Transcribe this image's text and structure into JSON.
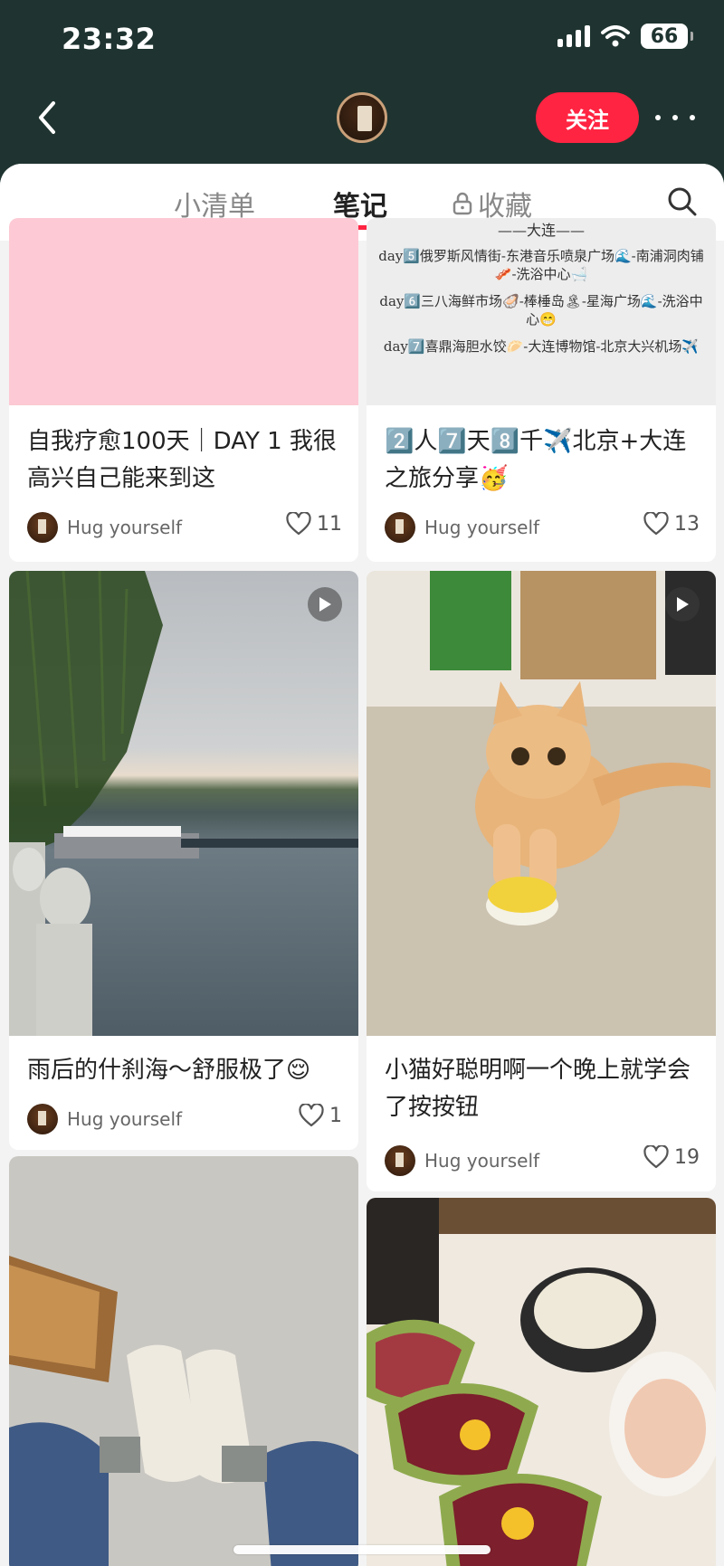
{
  "status_bar": {
    "time": "23:32",
    "battery": "66"
  },
  "header": {
    "follow_label": "关注"
  },
  "tabs": [
    {
      "label": "小清单"
    },
    {
      "label": "笔记"
    },
    {
      "label": "收藏"
    }
  ],
  "notes": [
    {
      "title": "自我疗愈100天｜DAY 1 我很高兴自己能来到这",
      "author": "Hug yourself",
      "likes": "11"
    },
    {
      "title": "2️⃣人7️⃣天8️⃣千✈️北京+大连之旅分享🥳",
      "author": "Hug yourself",
      "likes": "13",
      "image_text": {
        "heading": "——大连——",
        "line1": "day5️⃣俄罗斯风情街-东港音乐喷泉广场🌊-南浦洞肉铺🥓-洗浴中心🛁",
        "line2": "day6️⃣三八海鲜市场🦪-棒棰岛🏝-星海广场🌊-洗浴中心😁",
        "line3": "day7️⃣喜鼎海胆水饺🥟-大连博物馆-北京大兴机场✈️"
      }
    },
    {
      "title": "雨后的什刹海～舒服极了😌",
      "author": "Hug yourself",
      "likes": "1"
    },
    {
      "title": "小猫好聪明啊一个晚上就学会了按按钮",
      "author": "Hug yourself",
      "likes": "19"
    }
  ],
  "icons": {
    "back": "chevron-left-icon",
    "more": "more-dots-icon",
    "search": "search-icon",
    "lock": "lock-icon",
    "heart": "heart-icon",
    "play": "play-icon"
  },
  "colors": {
    "header_bg": "#1f3430",
    "accent": "#ff2442"
  }
}
